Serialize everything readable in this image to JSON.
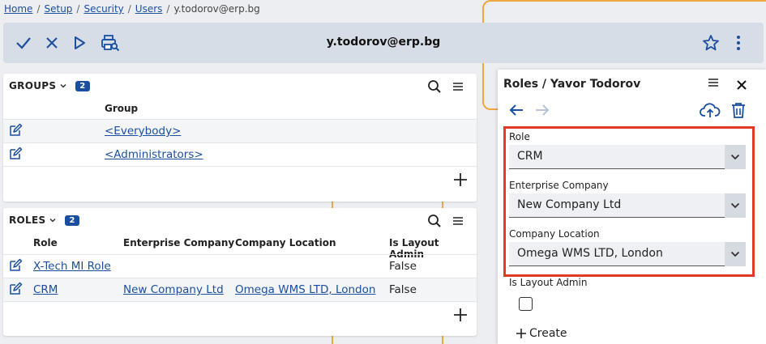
{
  "breadcrumb": {
    "home": "Home",
    "setup": "Setup",
    "security": "Security",
    "users": "Users",
    "current": "y.todorov@erp.bg",
    "separator": "/"
  },
  "toolbar": {
    "title": "y.todorov@erp.bg"
  },
  "groups": {
    "title": "GROUPS",
    "count": "2",
    "column": "Group",
    "rows": [
      "<Everybody>",
      "<Administrators>"
    ]
  },
  "roles": {
    "title": "ROLES",
    "count": "2",
    "columns": [
      "Role",
      "Enterprise Company",
      "Company Location",
      "Is Layout Admin"
    ],
    "rows": [
      {
        "role": "X-Tech MI Role",
        "company": "",
        "location": "",
        "is_layout_admin": "False"
      },
      {
        "role": "CRM",
        "company": "New Company Ltd",
        "location": "Omega WMS LTD, London",
        "is_layout_admin": "False"
      }
    ]
  },
  "side_panel": {
    "title": "Roles / Yavor Todorov",
    "role_label": "Role",
    "role_value": "CRM",
    "company_label": "Enterprise Company",
    "company_value": "New Company Ltd",
    "location_label": "Company Location",
    "location_value": "Omega WMS LTD, London",
    "layout_admin_label": "Is Layout Admin",
    "layout_admin_checked": false,
    "create_label": "Create"
  },
  "colors": {
    "accent": "#1a4fa0",
    "highlight": "#e03a22",
    "guide": "#f0a640",
    "toolbar_bg": "#d6dde6"
  }
}
